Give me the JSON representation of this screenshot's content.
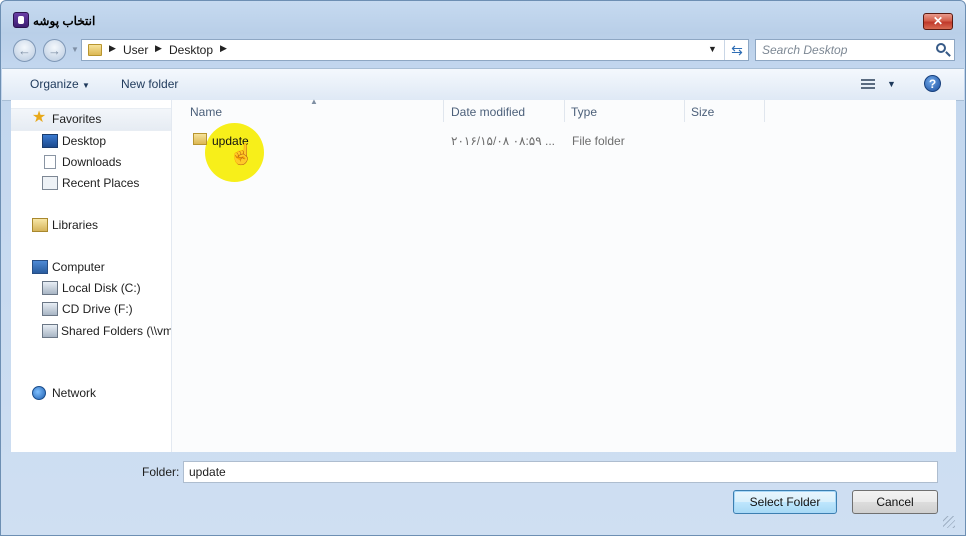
{
  "window": {
    "title": "انتخاب پوشه",
    "close_label": "✕"
  },
  "address_bar": {
    "breadcrumbs": [
      "User",
      "Desktop"
    ]
  },
  "search": {
    "placeholder": "Search Desktop"
  },
  "toolbar": {
    "organize_label": "Organize",
    "new_folder_label": "New folder"
  },
  "sidebar": {
    "favorites_label": "Favorites",
    "favorites": [
      "Desktop",
      "Downloads",
      "Recent Places"
    ],
    "libraries_label": "Libraries",
    "computer_label": "Computer",
    "computer": [
      "Local Disk (C:)",
      "CD Drive (F:)",
      "Shared Folders (\\\\vm"
    ],
    "network_label": "Network"
  },
  "file_list": {
    "columns": [
      "Name",
      "Date modified",
      "Type",
      "Size"
    ],
    "rows": [
      {
        "name": "update",
        "date_modified": "۲۰۱۶/۱۵/۰۸ ۰۸:۵۹ ...",
        "type": "File folder",
        "size": ""
      }
    ]
  },
  "footer": {
    "folder_label": "Folder:",
    "folder_value": "update",
    "select_button": "Select Folder",
    "cancel_button": "Cancel"
  },
  "colors": {
    "highlight": "#f7ef1a",
    "window_frame": "#b9cfe8",
    "close_button": "#c0392b"
  }
}
